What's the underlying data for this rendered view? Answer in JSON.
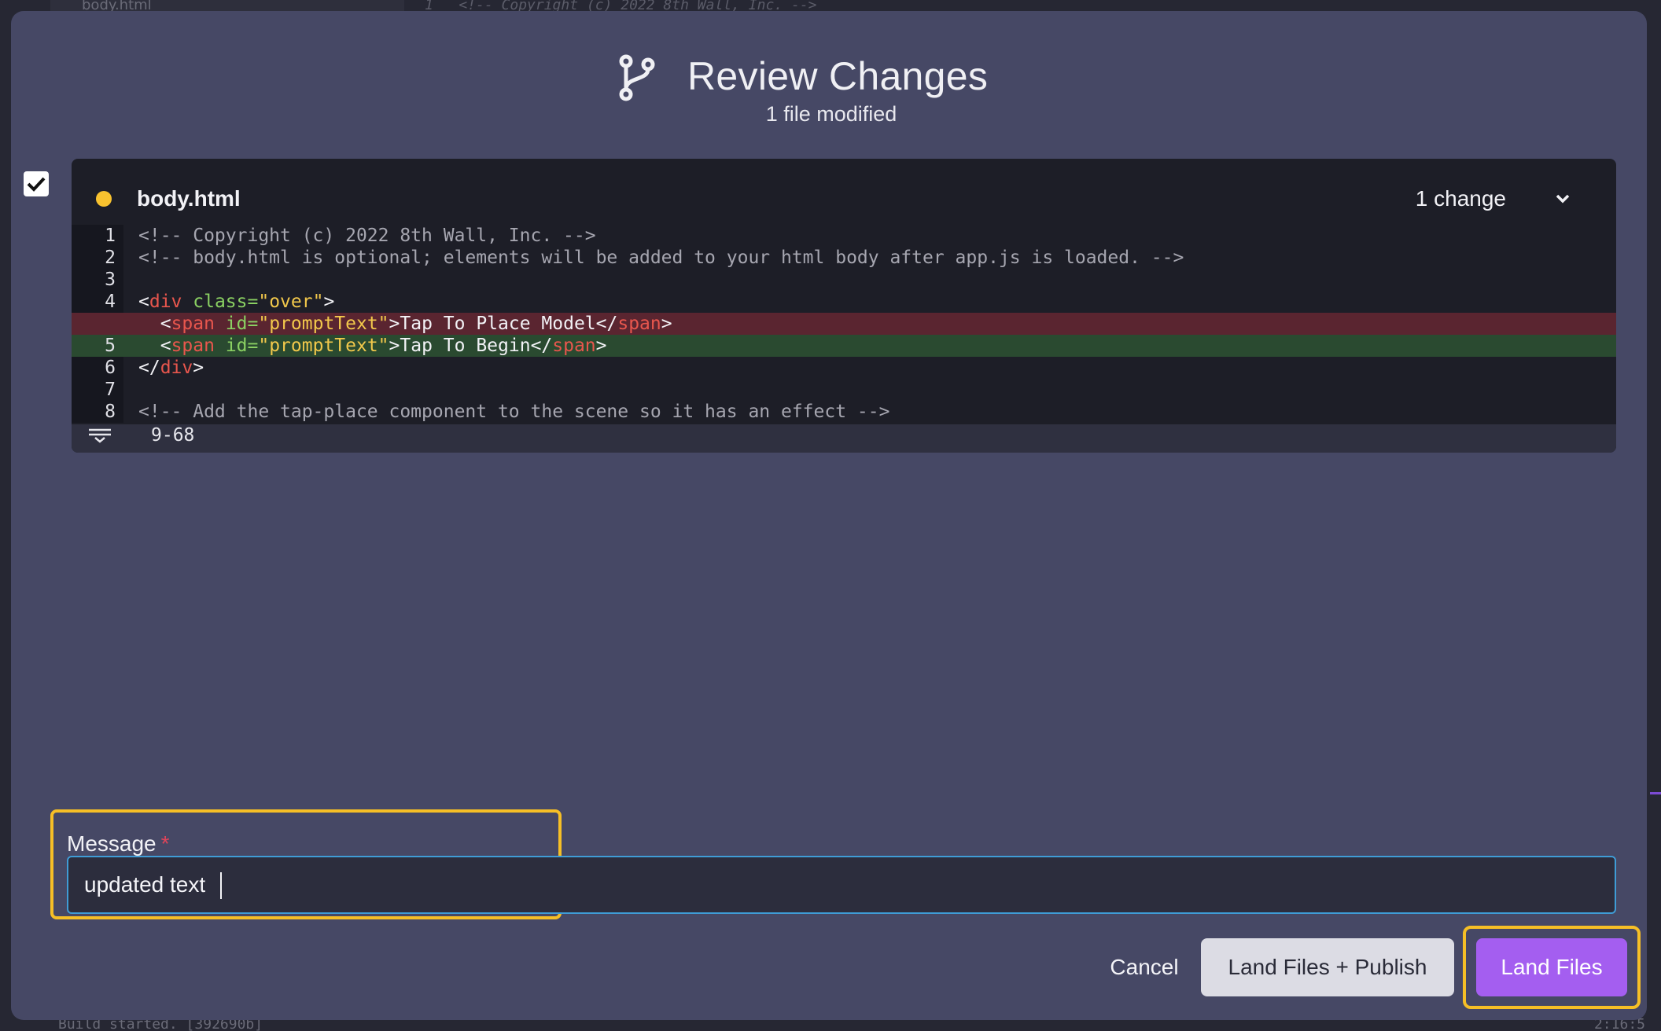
{
  "background": {
    "top_tab": "body.html",
    "top_code": "1   <!-- Copyright (c) 2022 8th Wall, Inc. -->",
    "status_text": "Build started. [392690b]",
    "status_time": "2:16:5"
  },
  "dialog": {
    "title": "Review Changes",
    "subtitle": "1 file modified",
    "icon": "git-branch-icon"
  },
  "file": {
    "checked": true,
    "status_color": "#f8c22f",
    "name": "body.html",
    "change_count": "1 change",
    "lines": [
      {
        "n": "1",
        "type": "context",
        "text": "<!-- Copyright (c) 2022 8th Wall, Inc. -->"
      },
      {
        "n": "2",
        "type": "context",
        "text": "<!-- body.html is optional; elements will be added to your html body after app.js is loaded. -->"
      },
      {
        "n": "3",
        "type": "context",
        "text": ""
      },
      {
        "n": "4",
        "type": "context",
        "text": "<div class=\"over\">"
      },
      {
        "n": "",
        "type": "removed",
        "text": "  <span id=\"promptText\">Tap To Place Model</span>"
      },
      {
        "n": "5",
        "type": "added",
        "text": "  <span id=\"promptText\">Tap To Begin</span>"
      },
      {
        "n": "6",
        "type": "context",
        "text": "</div>"
      },
      {
        "n": "7",
        "type": "context",
        "text": ""
      },
      {
        "n": "8",
        "type": "context",
        "text": "<!-- Add the tap-place component to the scene so it has an effect -->"
      }
    ],
    "folded_range": "9-68"
  },
  "message": {
    "label": "Message",
    "required_marker": "*",
    "value": "updated text"
  },
  "actions": {
    "cancel": "Cancel",
    "land_publish": "Land Files + Publish",
    "land": "Land Files"
  },
  "colors": {
    "accent": "#a45ef0",
    "highlight": "#f6bf26",
    "removed_bg": "#5a2530",
    "added_bg": "#2a4a30"
  }
}
